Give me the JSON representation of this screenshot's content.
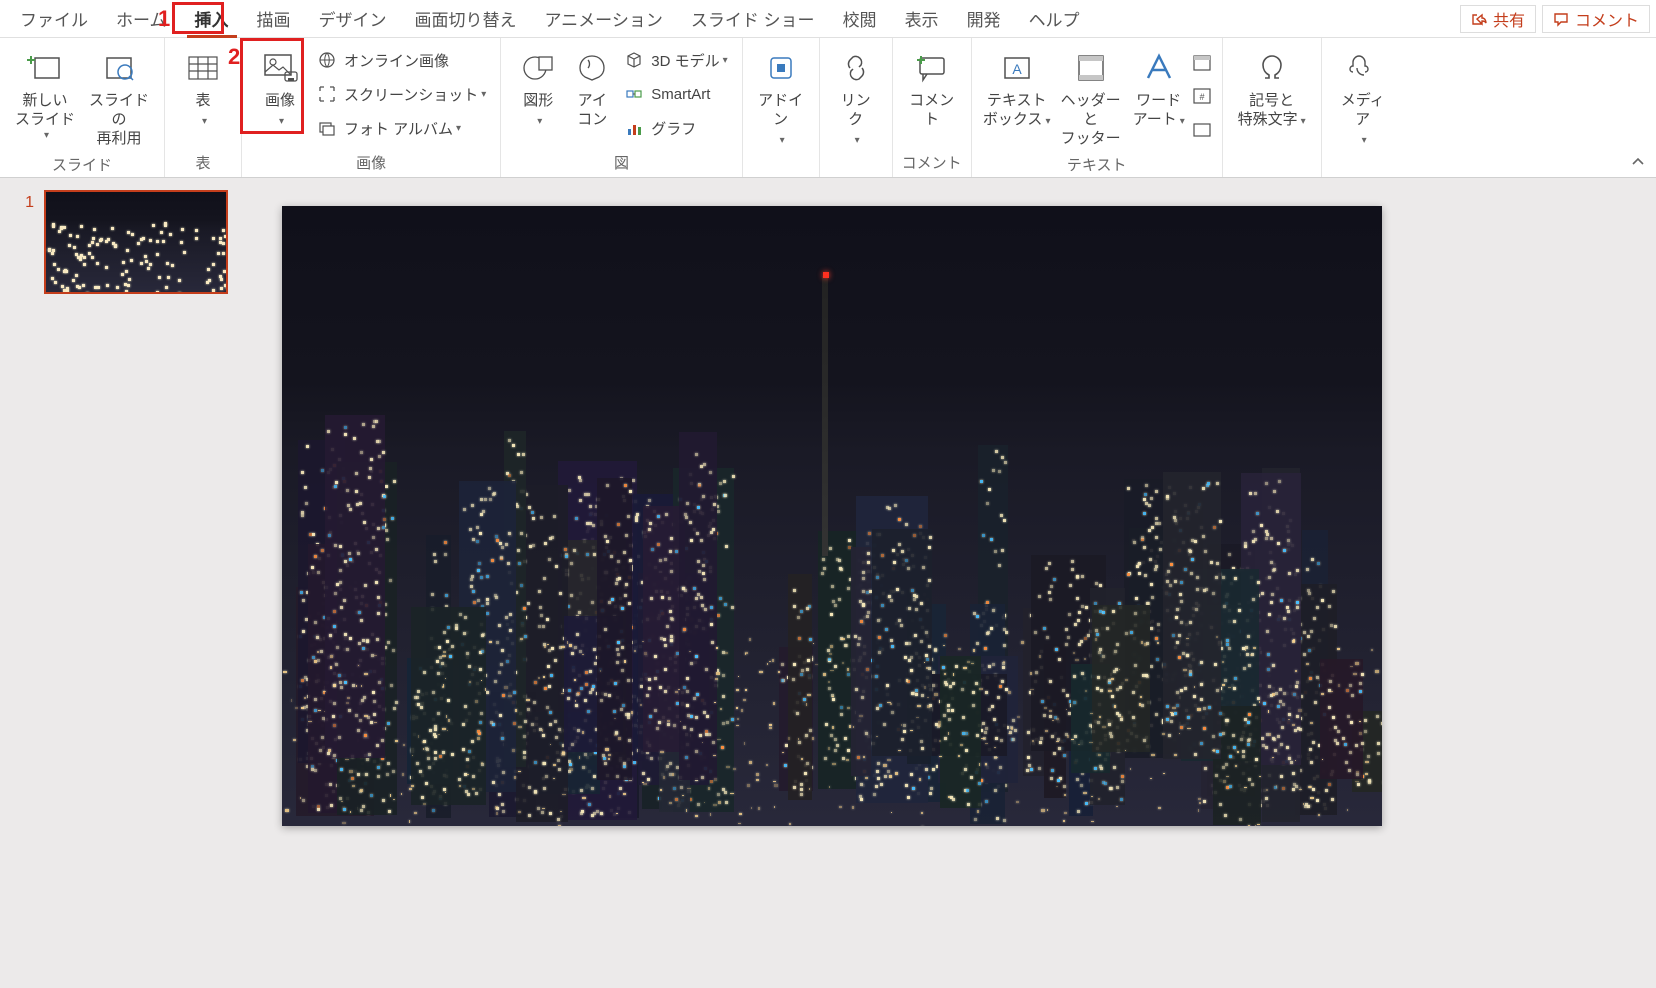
{
  "tabs": {
    "file": "ファイル",
    "home": "ホーム",
    "insert": "挿入",
    "draw": "描画",
    "design": "デザイン",
    "transition": "画面切り替え",
    "animation": "アニメーション",
    "slideshow": "スライド ショー",
    "review": "校閲",
    "view": "表示",
    "developer": "開発",
    "help": "ヘルプ"
  },
  "actions": {
    "share": "共有",
    "comment": "コメント"
  },
  "annotations": {
    "num1": "1",
    "num2": "2"
  },
  "groups": {
    "slides": {
      "label": "スライド",
      "new_slide": "新しい\nスライド",
      "reuse": "スライドの\n再利用"
    },
    "tables": {
      "label": "表",
      "table": "表"
    },
    "images": {
      "label": "画像",
      "picture": "画像",
      "online": "オンライン画像",
      "screenshot": "スクリーンショット",
      "album": "フォト アルバム"
    },
    "illustrations": {
      "label": "図",
      "shapes": "図形",
      "icons": "アイ\nコン",
      "model3d": "3D モデル",
      "smartart": "SmartArt",
      "chart": "グラフ"
    },
    "addins": {
      "label": "",
      "addin": "アドイ\nン"
    },
    "links": {
      "label": "",
      "link": "リン\nク"
    },
    "comments": {
      "label": "コメント",
      "comment": "コメン\nト"
    },
    "text": {
      "label": "テキスト",
      "textbox": "テキスト\nボックス",
      "header": "ヘッダーと\nフッター",
      "wordart": "ワード\nアート"
    },
    "symbols": {
      "label": "",
      "symbol": "記号と\n特殊文字"
    },
    "media": {
      "label": "",
      "media": "メディ\nア"
    }
  },
  "thumb": {
    "num": "1"
  }
}
